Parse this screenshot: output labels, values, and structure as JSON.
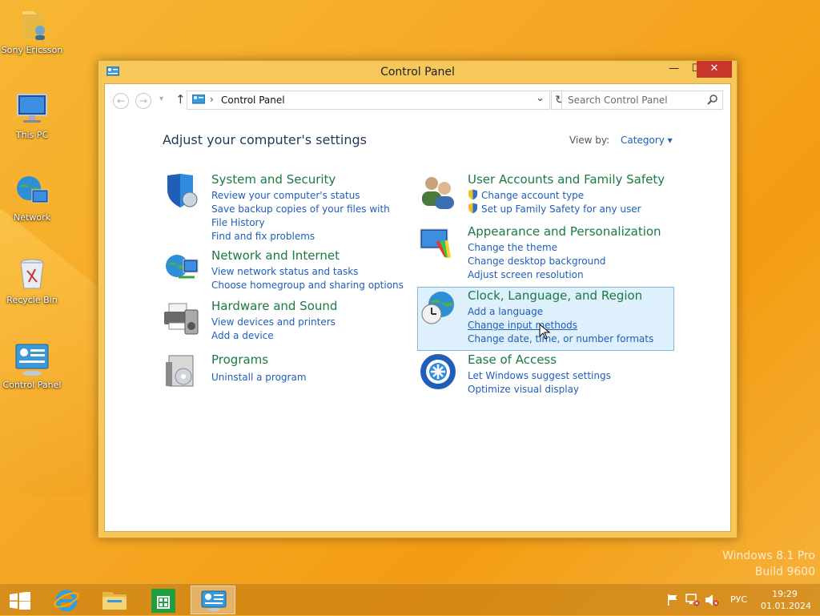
{
  "desktop": {
    "icons": [
      {
        "label": "Sony Ericsson"
      },
      {
        "label": "This PC"
      },
      {
        "label": "Network"
      },
      {
        "label": "Recycle Bin"
      },
      {
        "label": "Control Panel"
      }
    ],
    "watermark": {
      "line1": "Windows 8.1 Pro",
      "line2": "Build 9600"
    }
  },
  "window": {
    "title": "Control Panel",
    "buttons": {
      "minimize": "—",
      "maximize": "☐",
      "close": "✕"
    },
    "nav": {
      "back": "←",
      "forward": "→",
      "recent": "▾",
      "up": "↑",
      "breadcrumb_sep": "›",
      "location": "Control Panel",
      "dropdown": "⌄",
      "refresh": "↻",
      "search_placeholder": "Search Control Panel"
    },
    "heading": "Adjust your computer's settings",
    "view_by_label": "View by:",
    "view_by_value": "Category",
    "view_by_caret": "▾"
  },
  "categories": {
    "system": {
      "title": "System and Security",
      "links": [
        "Review your computer's status",
        "Save backup copies of your files with File History",
        "Find and fix problems"
      ]
    },
    "network": {
      "title": "Network and Internet",
      "links": [
        "View network status and tasks",
        "Choose homegroup and sharing options"
      ]
    },
    "hardware": {
      "title": "Hardware and Sound",
      "links": [
        "View devices and printers",
        "Add a device"
      ]
    },
    "programs": {
      "title": "Programs",
      "links": [
        "Uninstall a program"
      ]
    },
    "users": {
      "title": "User Accounts and Family Safety",
      "links": [
        "Change account type",
        "Set up Family Safety for any user"
      ]
    },
    "appearance": {
      "title": "Appearance and Personalization",
      "links": [
        "Change the theme",
        "Change desktop background",
        "Adjust screen resolution"
      ]
    },
    "clock": {
      "title": "Clock, Language, and Region",
      "links": [
        "Add a language",
        "Change input methods",
        "Change date, time, or number formats"
      ]
    },
    "ease": {
      "title": "Ease of Access",
      "links": [
        "Let Windows suggest settings",
        "Optimize visual display"
      ]
    }
  },
  "taskbar": {
    "language": "РУС",
    "time": "19:29",
    "date": "01.01.2024"
  }
}
